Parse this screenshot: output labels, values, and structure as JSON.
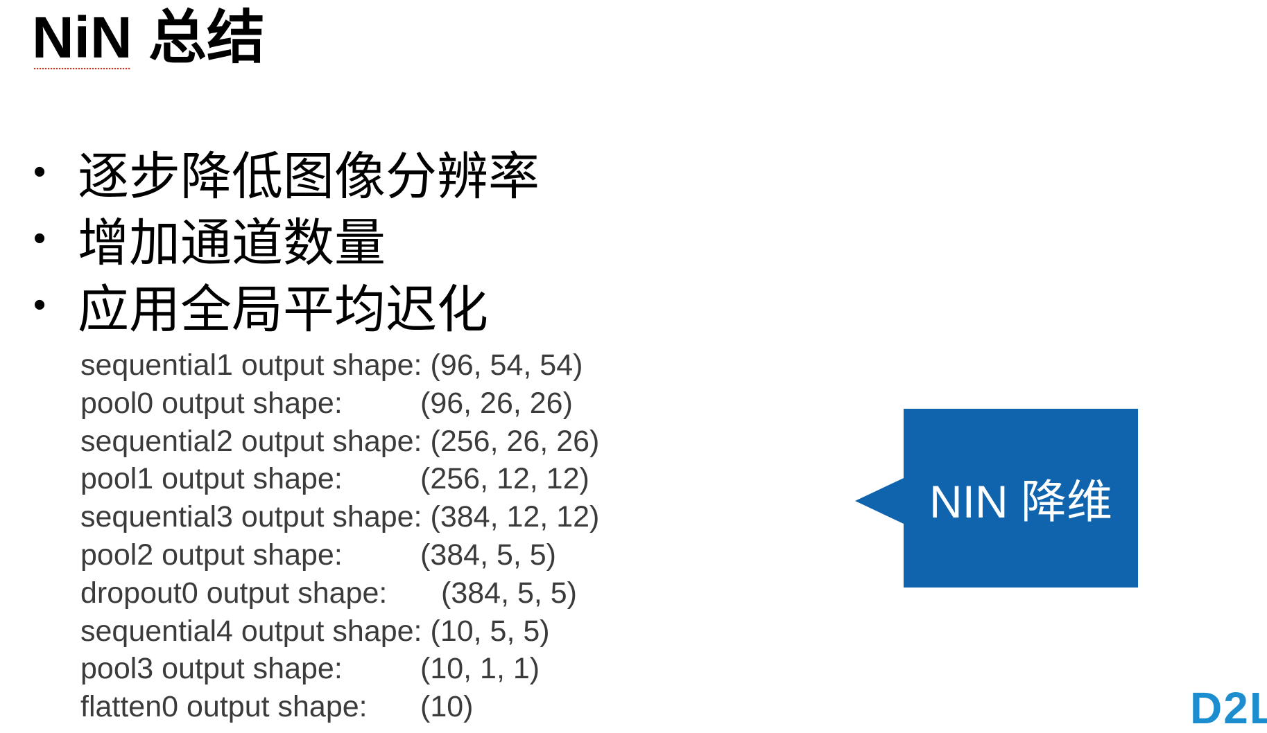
{
  "slide": {
    "title_word": "NiN",
    "title_rest": " 总结",
    "bullets": [
      {
        "dot": "•",
        "text": "逐步降低图像分辨率"
      },
      {
        "dot": "•",
        "text": "增加通道数量"
      },
      {
        "dot": "•",
        "text": "应用全局平均迟化"
      }
    ],
    "shape_log": [
      {
        "label": "sequential1 output shape:",
        "value": "(96, 54, 54)"
      },
      {
        "label": "pool0 output shape:",
        "value": "(96, 26, 26)"
      },
      {
        "label": "sequential2 output shape:",
        "value": "(256, 26, 26)"
      },
      {
        "label": "pool1 output shape:",
        "value": "(256, 12, 12)"
      },
      {
        "label": "sequential3 output shape:",
        "value": "(384, 12, 12)"
      },
      {
        "label": "pool2 output shape:",
        "value": "(384, 5, 5)"
      },
      {
        "label": "dropout0 output shape:",
        "value": "(384, 5, 5)"
      },
      {
        "label": "sequential4 output shape:",
        "value": "(10, 5, 5)"
      },
      {
        "label": "pool3 output shape:",
        "value": "(10, 1, 1)"
      },
      {
        "label": "flatten0 output shape:",
        "value": "(10)"
      }
    ],
    "callout": {
      "text": "NIN 降维",
      "color": "#1064ae"
    },
    "logo": "D2L"
  }
}
